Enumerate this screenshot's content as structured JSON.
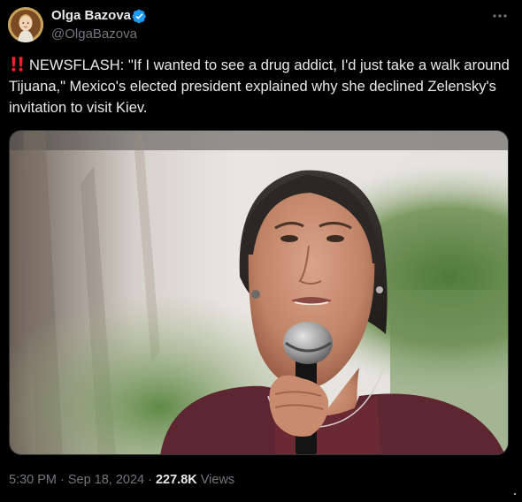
{
  "author": {
    "display_name": "Olga Bazova",
    "handle": "@OlgaBazova",
    "verified": true,
    "avatar_icon": "portrait-avatar"
  },
  "tweet": {
    "alert_icon": "double-exclamation-icon",
    "text": "NEWSFLASH: \"If I wanted to see a drug addict, I'd just take a walk around Tijuana,\" Mexico's elected president explained why she declined Zelensky's invitation to visit Kiev.",
    "media_icon": "woman-speaking-into-microphone-photo"
  },
  "meta": {
    "time": "5:30 PM",
    "date": "Sep 18, 2024",
    "separator": "·",
    "views_count": "227.8K",
    "views_label": "Views"
  },
  "colors": {
    "background": "#000000",
    "text_primary": "#e7e9ea",
    "text_secondary": "#71767b",
    "verified_blue": "#1d9bf0",
    "alert_red": "#f4212e"
  }
}
